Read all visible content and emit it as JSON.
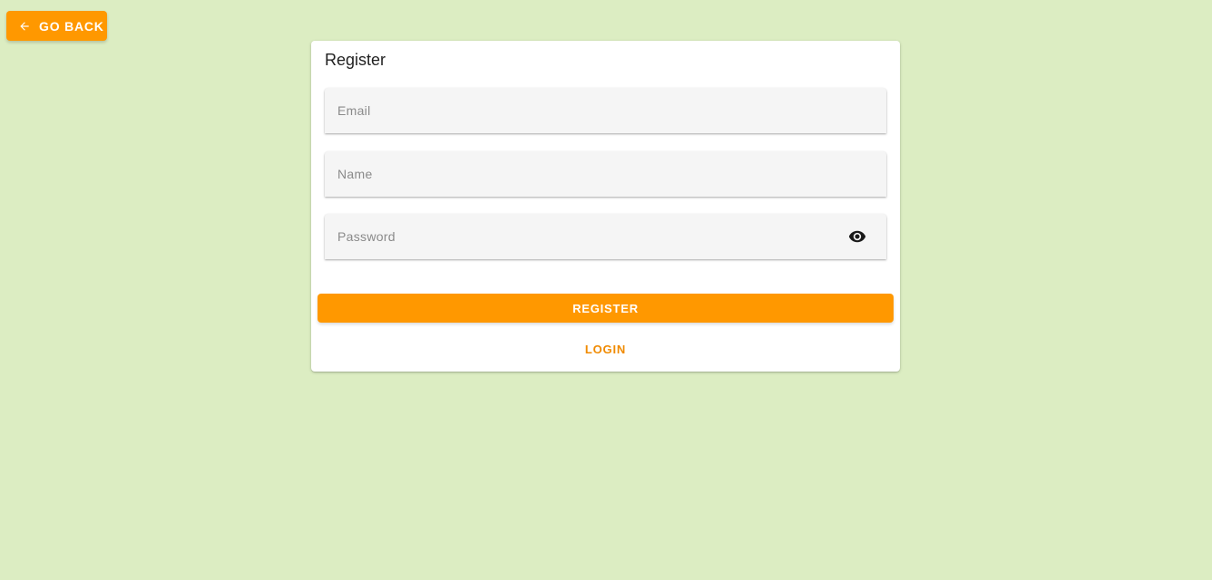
{
  "header": {
    "back_button": {
      "label": "GO BACK",
      "icon": "arrow-left-icon"
    }
  },
  "form": {
    "title": "Register",
    "fields": {
      "email": {
        "value": "",
        "placeholder": "Email"
      },
      "name": {
        "value": "",
        "placeholder": "Name"
      },
      "password": {
        "value": "",
        "placeholder": "Password",
        "toggle_icon": "eye-icon"
      }
    },
    "register_label": "REGISTER",
    "login_label": "LOGIN"
  },
  "colors": {
    "background": "#dcedc2",
    "accent": "#ff9800",
    "card": "#ffffff",
    "field_bg": "#f5f5f5"
  }
}
